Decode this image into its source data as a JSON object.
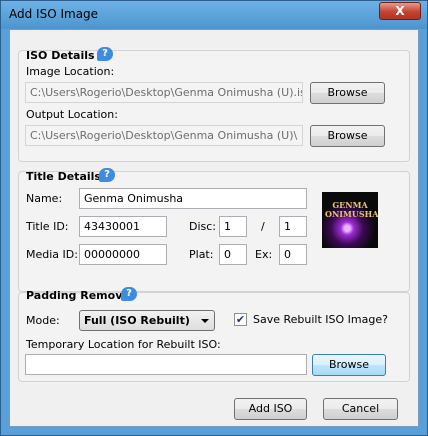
{
  "window": {
    "title": "Add ISO Image",
    "close_symbol": "X"
  },
  "iso_details": {
    "title": "ISO Details",
    "image_location_label": "Image Location:",
    "image_location_value": "C:\\Users\\Rogerio\\Desktop\\Genma Onimusha (U).iso",
    "output_location_label": "Output Location:",
    "output_location_value": "C:\\Users\\Rogerio\\Desktop\\Genma Onimusha (U)\\",
    "browse_label": "Browse"
  },
  "title_details": {
    "title": "Title Details",
    "name_label": "Name:",
    "name_value": "Genma Onimusha",
    "title_id_label": "Title ID:",
    "title_id_value": "43430001",
    "disc_label": "Disc:",
    "disc_value": "1",
    "disc_separator": "/",
    "disc_total_value": "1",
    "media_id_label": "Media ID:",
    "media_id_value": "00000000",
    "plat_label": "Plat:",
    "plat_value": "0",
    "ex_label": "Ex:",
    "ex_value": "0",
    "cover_text": "GENMA ONIMUSHA"
  },
  "padding_removal": {
    "title": "Padding Removal",
    "mode_label": "Mode:",
    "mode_value": "Full (ISO Rebuilt)",
    "save_rebuilt_label": "Save Rebuilt ISO Image?",
    "save_rebuilt_checked": true,
    "check_symbol": "✔",
    "temp_location_label": "Temporary Location for Rebuilt ISO:",
    "temp_location_value": "",
    "browse_label": "Browse"
  },
  "actions": {
    "add_label": "Add ISO",
    "cancel_label": "Cancel"
  },
  "help_symbol": "?"
}
